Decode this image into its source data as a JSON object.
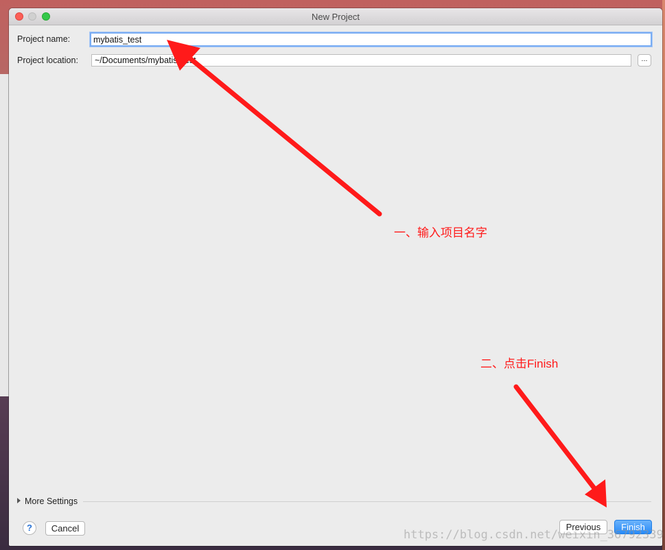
{
  "window": {
    "title": "New Project"
  },
  "form": {
    "project_name_label": "Project name:",
    "project_name_value": "mybatis_test",
    "project_location_label": "Project location:",
    "project_location_value": "~/Documents/mybatis_test",
    "browse_label": "..."
  },
  "footer": {
    "more_settings_label": "More Settings",
    "help_label": "?",
    "cancel_label": "Cancel",
    "previous_label": "Previous",
    "finish_label": "Finish"
  },
  "annotations": {
    "step1": "一、输入项目名字",
    "step2": "二、点击Finish",
    "color": "#ff1a1a"
  },
  "watermark": "https://blog.csdn.net/weixin_36792339",
  "colors": {
    "accent": "#268af9",
    "focus_ring": "#7aadf3"
  }
}
